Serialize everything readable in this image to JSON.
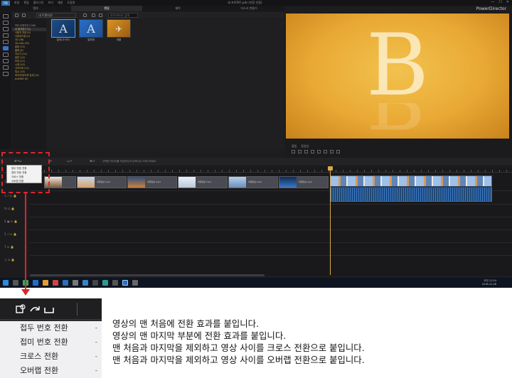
{
  "app": {
    "menu": [
      "파일",
      "편집",
      "플러그인",
      "보기",
      "재생",
      "도움말"
    ],
    "window_title": "새 프로젝트.pds (저장 안됨)",
    "brand": "PowerDirector",
    "window_controls": [
      "—",
      "☐",
      "✕"
    ]
  },
  "mode_tabs": [
    {
      "label": "캡처"
    },
    {
      "label": "편집"
    },
    {
      "label": "제작"
    },
    {
      "label": "디스크 만들기"
    }
  ],
  "library": {
    "dropdown_value": "내 트랜지션",
    "search_placeholder": "라이브러리 검색"
  },
  "categories": [
    "모든 트랜지션 (106)",
    "내 즐겨찾기 (0)",
    "사용자 지정 (0)",
    "다운로드됨 (0)",
    "3D (36)",
    "3D-Like (52)",
    "알파 (75)",
    "블록 (8)",
    "지우기 (14)",
    "일반 (14)",
    "모양 (12)",
    "시계 (10)",
    "사이드바 (11)",
    "특수 (14)",
    "와이프(와이퍼 효과) (9)",
    "proDAD (0)"
  ],
  "thumbnails": [
    {
      "label": "알파(사이드)",
      "letter": "A"
    },
    {
      "label": "알파원",
      "letter": "A"
    },
    {
      "label": "새물"
    }
  ],
  "preview": {
    "letter": "B",
    "tabs": [
      "클립",
      "동영상"
    ]
  },
  "timeline": {
    "toolbar_hint": "선택한 미디어를 타임라인의 트랙으로 드래그하세요",
    "clip_label": "여행영상.mp4"
  },
  "mini_menu": {
    "items": [
      "접두 번호 전환",
      "접미 번호 전환",
      "크로스 전환",
      "오버랩 전환"
    ]
  },
  "taskbar": {
    "time": "오전 11:24",
    "date": "2018-12-26"
  },
  "zoom_menu": {
    "items": [
      "접두 번호 전환",
      "접미 번호 전환",
      "크로스 전환",
      "오버랩 전환"
    ],
    "arrow": "-"
  },
  "descriptions": [
    "영상의 맨 처음에 전환 효과를 붙입니다.",
    "영상의 맨 마지막 부분에 전환 효과를 붙입니다.",
    "맨 처음과 마지막을 제외하고 영상 사이를 크로스 전환으로 붙입니다.",
    "맨 처음과 마지막을 제외하고 영상 사이를 오버랩 전환으로 붙입니다."
  ],
  "colors": {
    "annotation": "#e0242b",
    "preview_bg": "#e9a934",
    "accent": "#3a75c4"
  }
}
